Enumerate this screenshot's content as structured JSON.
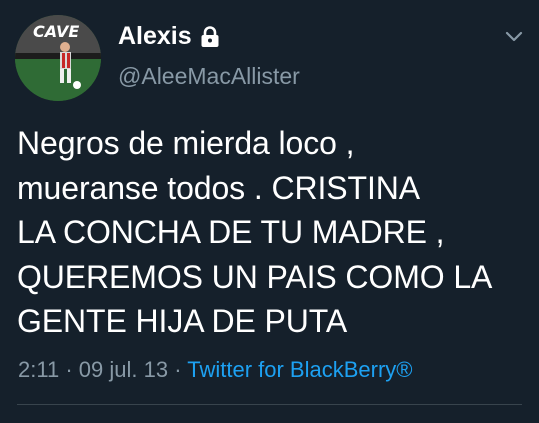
{
  "author": {
    "display_name": "Alexis",
    "handle": "@AleeMacAllister",
    "protected": true,
    "avatar_text": "CAVE"
  },
  "icons": {
    "lock": "lock-icon",
    "menu": "chevron-down-icon"
  },
  "tweet": {
    "lines": [
      "Negros de mierda loco ,",
      "mueranse todos . CRISTINA",
      "LA CONCHA DE TU MADRE ,",
      "QUEREMOS UN PAIS COMO LA",
      "GENTE HIJA DE PUTA"
    ]
  },
  "meta": {
    "time": "2:11",
    "date": "09 jul. 13",
    "separator": "·",
    "source": "Twitter for BlackBerry®"
  },
  "colors": {
    "background": "#15202b",
    "text": "#ffffff",
    "secondary": "#8899a6",
    "link": "#1da1f2"
  }
}
